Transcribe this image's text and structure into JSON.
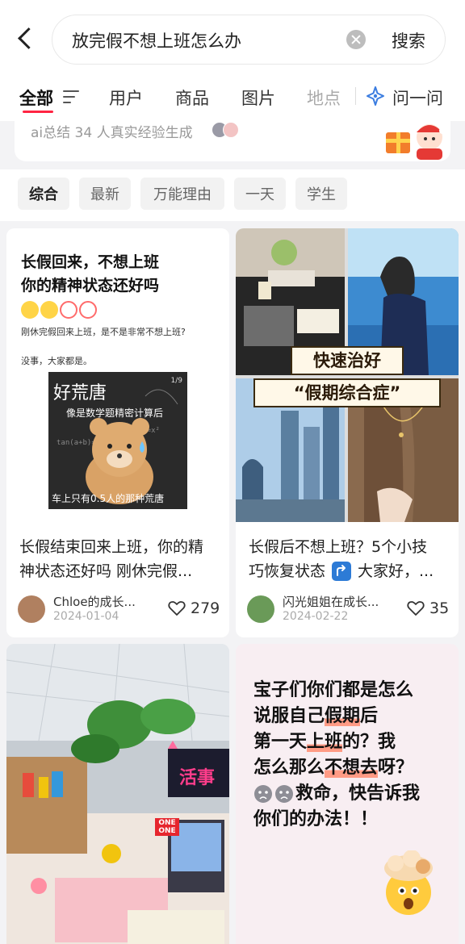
{
  "header": {
    "search_query": "放完假不想上班怎么办",
    "search_button": "搜索"
  },
  "tabs": [
    {
      "label": "全部",
      "active": true
    },
    {
      "label": "用户"
    },
    {
      "label": "商品"
    },
    {
      "label": "图片"
    },
    {
      "label": "地点"
    },
    {
      "label": "问一问"
    }
  ],
  "ai_summary": {
    "text": "ai总结 34 人真实经验生成"
  },
  "filters": [
    "综合",
    "最新",
    "万能理由",
    "一天",
    "学生"
  ],
  "feed": [
    {
      "cover": {
        "title_line1": "长假回来，不想上班",
        "title_line2": "你的精神状态还好吗",
        "body_line1": "刚休完假回来上班，是不是非常不想上班?",
        "body_line2": "没事，大家都是。",
        "meme_title": "好荒唐",
        "meme_sub": "像是数学题精密计算后",
        "meme_bottom": "车上只有0.5人的那种荒唐",
        "meme_page": "1/9"
      },
      "title_line1": "长假结束回来上班，你的精",
      "title_line2": "神状态还好吗 刚休完假...",
      "author": "Chloe的成长...",
      "date": "2024-01-04",
      "likes": "279",
      "avatar_color": "#b08060"
    },
    {
      "cover": {
        "banner_top": "快速治好",
        "banner_bottom": "“假期综合症”"
      },
      "title_line1": "长假后不想上班？5个小技",
      "title_line2": "巧恢复状态",
      "title_tail": "大家好，...",
      "author": "闪光姐姐在成长...",
      "date": "2024-02-22",
      "likes": "35",
      "avatar_color": "#6a9a58"
    },
    {
      "cover": {
        "sign": "活事",
        "box_label_1": "ONE",
        "box_label_2": "ONE"
      }
    },
    {
      "cover": {
        "l1": "宝子们你们都是怎么",
        "l2a": "说服自己",
        "l2b": "假期",
        "l2c": "后",
        "l3a": "第一天",
        "l3b": "上班",
        "l3c": "的？我",
        "l4a": "怎么那么",
        "l4b": "不想去",
        "l4c": "呀？",
        "l5": "救命，快告诉我",
        "l6": "你们的办法！！"
      }
    }
  ],
  "colors": {
    "accent": "#ff2442",
    "highlight": "#ff9b85",
    "card4_bg": "#f8eef2"
  }
}
